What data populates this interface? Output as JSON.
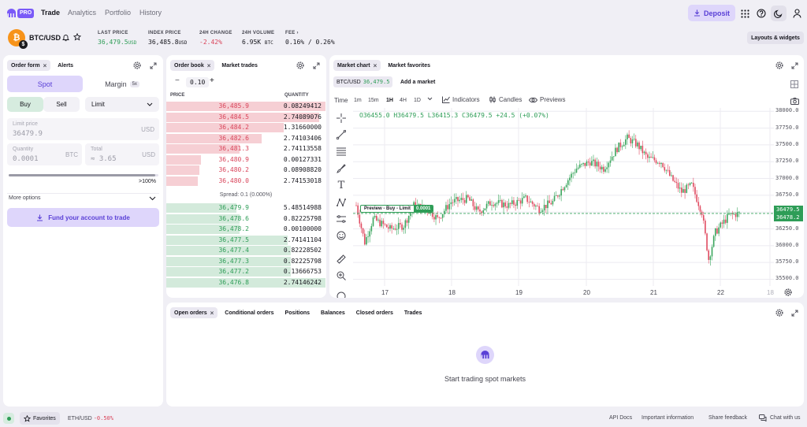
{
  "nav": {
    "logo_badge": "PRO",
    "links": [
      "Trade",
      "Analytics",
      "Portfolio",
      "History"
    ],
    "deposit": "Deposit"
  },
  "ticker": {
    "pair": "BTC/USD",
    "coin_symbol": "₿",
    "sub_symbol": "$",
    "last_price_label": "LAST PRICE",
    "last_price": "36,479.5",
    "index_price_label": "INDEX PRICE",
    "index_price": "36,485.8",
    "change_label": "24H CHANGE",
    "change": "-2.42%",
    "volume_label": "24H VOLUME",
    "volume": "6.95K",
    "fee_label": "FEE",
    "fee_maker": "0.16%",
    "fee_taker": "0.26%",
    "unit_usd": "USD",
    "unit_btc": "BTC"
  },
  "layouts_button": "Layouts & widgets",
  "order_form": {
    "tabs": [
      "Order form",
      "Alerts"
    ],
    "spot": "Spot",
    "margin": "Margin",
    "margin_badge": "5x",
    "buy": "Buy",
    "sell": "Sell",
    "order_type": "Limit",
    "limit_label": "Limit price",
    "limit_value": "36479.9",
    "limit_unit": "USD",
    "qty_label": "Quantity",
    "qty_value": "0.0001",
    "qty_unit": "BTC",
    "total_label": "Total",
    "total_value": "≈ 3.65",
    "total_unit": "USD",
    "slider_max": ">100%",
    "slider_fill": 0.98,
    "more_options": "More options",
    "fund": "Fund your account to trade"
  },
  "order_book": {
    "tabs": [
      "Order book",
      "Market trades"
    ],
    "step": "0.10",
    "price_header": "PRICE",
    "qty_header": "QUANTITY",
    "spread": "Spread: 0.1 (0.000%)",
    "asks": [
      {
        "price": "36,485.9",
        "qty": "0.08249412",
        "depth": 1.0
      },
      {
        "price": "36,484.5",
        "qty": "2.74089076",
        "depth": 0.96
      },
      {
        "price": "36,484.2",
        "qty": "1.31660000",
        "depth": 0.74
      },
      {
        "price": "36,482.6",
        "qty": "2.74103406",
        "depth": 0.6
      },
      {
        "price": "36,481.3",
        "qty": "2.74113558",
        "depth": 0.46
      },
      {
        "price": "36,480.9",
        "qty": "0.00127331",
        "depth": 0.22
      },
      {
        "price": "36,480.2",
        "qty": "0.08908820",
        "depth": 0.21
      },
      {
        "price": "36,480.0",
        "qty": "2.74153018",
        "depth": 0.2
      }
    ],
    "bids": [
      {
        "price": "36,479.9",
        "qty": "5.48514988",
        "depth": 0.44
      },
      {
        "price": "36,478.6",
        "qty": "0.82225798",
        "depth": 0.46
      },
      {
        "price": "36,478.2",
        "qty": "0.00100000",
        "depth": 0.46
      },
      {
        "price": "36,477.5",
        "qty": "2.74141104",
        "depth": 0.76
      },
      {
        "price": "36,477.4",
        "qty": "0.82228502",
        "depth": 0.78
      },
      {
        "price": "36,477.3",
        "qty": "0.82225798",
        "depth": 0.78
      },
      {
        "price": "36,477.2",
        "qty": "0.13666753",
        "depth": 0.78
      },
      {
        "price": "36,476.8",
        "qty": "2.74146242",
        "depth": 1.0
      }
    ]
  },
  "chart": {
    "tabs": [
      "Market chart",
      "Market favorites"
    ],
    "pair": "BTC/USD",
    "pair_price": "36,479.5",
    "add_market": "Add a market",
    "time_label": "Time",
    "timeframes": [
      "1m",
      "15m",
      "1H",
      "4H",
      "1D"
    ],
    "active_tf": "1H",
    "indicators": "Indicators",
    "candles": "Candles",
    "previews": "Previews",
    "ohlc": "O36455.0  H36479.5  L36415.3  C36479.5  +24.5 (+0.07%)",
    "preview": "Preview - Buy - Limit",
    "preview_qty": "0.0001",
    "price_tag_1": "36479.5",
    "price_tag_2": "36478.2",
    "y_ticks": [
      "38000.0",
      "37750.0",
      "37500.0",
      "37250.0",
      "37000.0",
      "36750.0",
      "36500.0",
      "36250.0",
      "36000.0",
      "35750.0",
      "35500.0"
    ],
    "x_ticks": [
      "17",
      "18",
      "19",
      "20",
      "21",
      "22",
      "18"
    ]
  },
  "chart_data": {
    "type": "candlestick",
    "x": [
      "17",
      "18",
      "19",
      "20",
      "21",
      "22",
      "18"
    ],
    "ylim": [
      35400,
      38050
    ],
    "y_ticks": [
      35500,
      35750,
      36000,
      36250,
      36500,
      36750,
      37000,
      37250,
      37500,
      37750,
      38000
    ],
    "last_price": 36479.5,
    "title": "",
    "xlabel": "",
    "ylabel": ""
  },
  "bottom_panel": {
    "tabs": [
      "Open orders",
      "Conditional orders",
      "Positions",
      "Balances",
      "Closed orders",
      "Trades"
    ],
    "empty": "Start trading spot markets"
  },
  "footer": {
    "favorites": "Favorites",
    "fav_pair": "ETH/USD",
    "fav_change": "-0.50%",
    "links": [
      "API Docs",
      "Important information",
      "Share feedback",
      "Chat with us"
    ]
  }
}
